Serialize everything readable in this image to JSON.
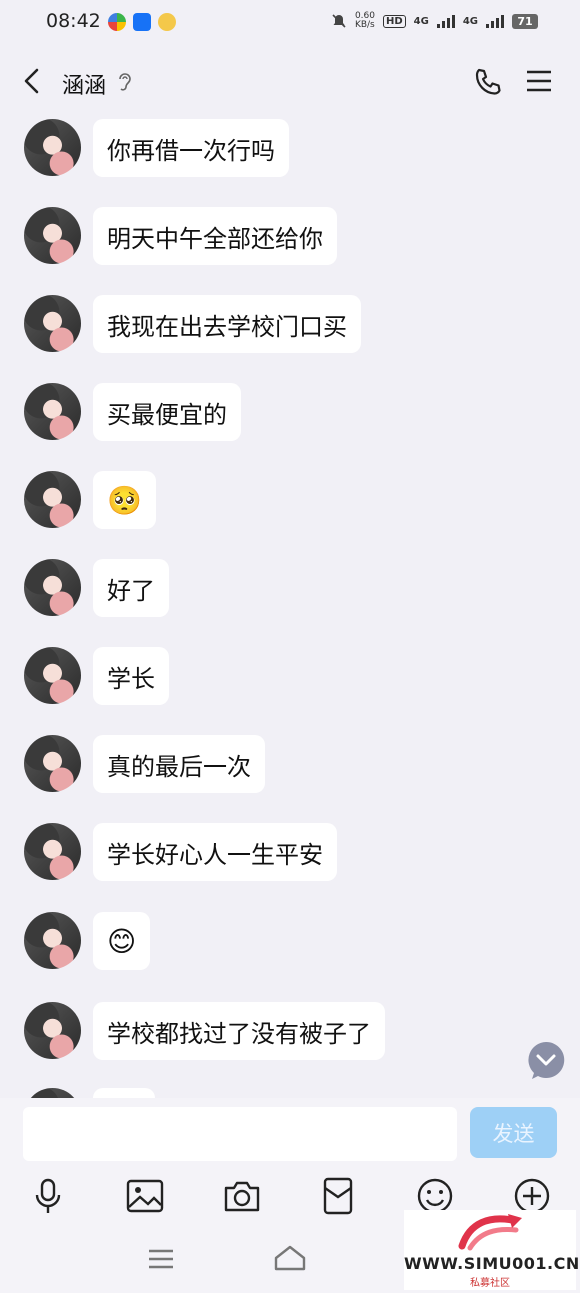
{
  "status_bar": {
    "time": "08:42",
    "net_speed": "0.60",
    "net_unit": "KB/s",
    "hd_label": "HD",
    "net1": "4G",
    "net2": "4G",
    "battery": "71"
  },
  "header": {
    "title": "涵涵",
    "icons": [
      "back-icon",
      "ear-icon",
      "phone-icon",
      "menu-icon"
    ]
  },
  "messages": [
    {
      "text": "你再借一次行吗"
    },
    {
      "text": "明天中午全部还给你"
    },
    {
      "text": "我现在出去学校门口买"
    },
    {
      "text": "买最便宜的"
    },
    {
      "text": "🥺"
    },
    {
      "text": "好了"
    },
    {
      "text": "学长"
    },
    {
      "text": "真的最后一次"
    },
    {
      "text": "学长好心人一生平安"
    },
    {
      "text": "😊"
    },
    {
      "text": "学校都找过了没有被子了"
    }
  ],
  "composer": {
    "input_value": "",
    "send_label": "发送"
  },
  "toolbar_icons": [
    "microphone-icon",
    "image-icon",
    "camera-icon",
    "red-packet-icon",
    "emoji-icon",
    "plus-icon"
  ],
  "watermark": {
    "url": "WWW.SIMU001.CN",
    "subtitle": "私募社区"
  },
  "colors": {
    "background": "#f1f0f6",
    "bubble": "#ffffff",
    "send_button": "#9ed0f6",
    "watermark_red": "#e0334a"
  }
}
